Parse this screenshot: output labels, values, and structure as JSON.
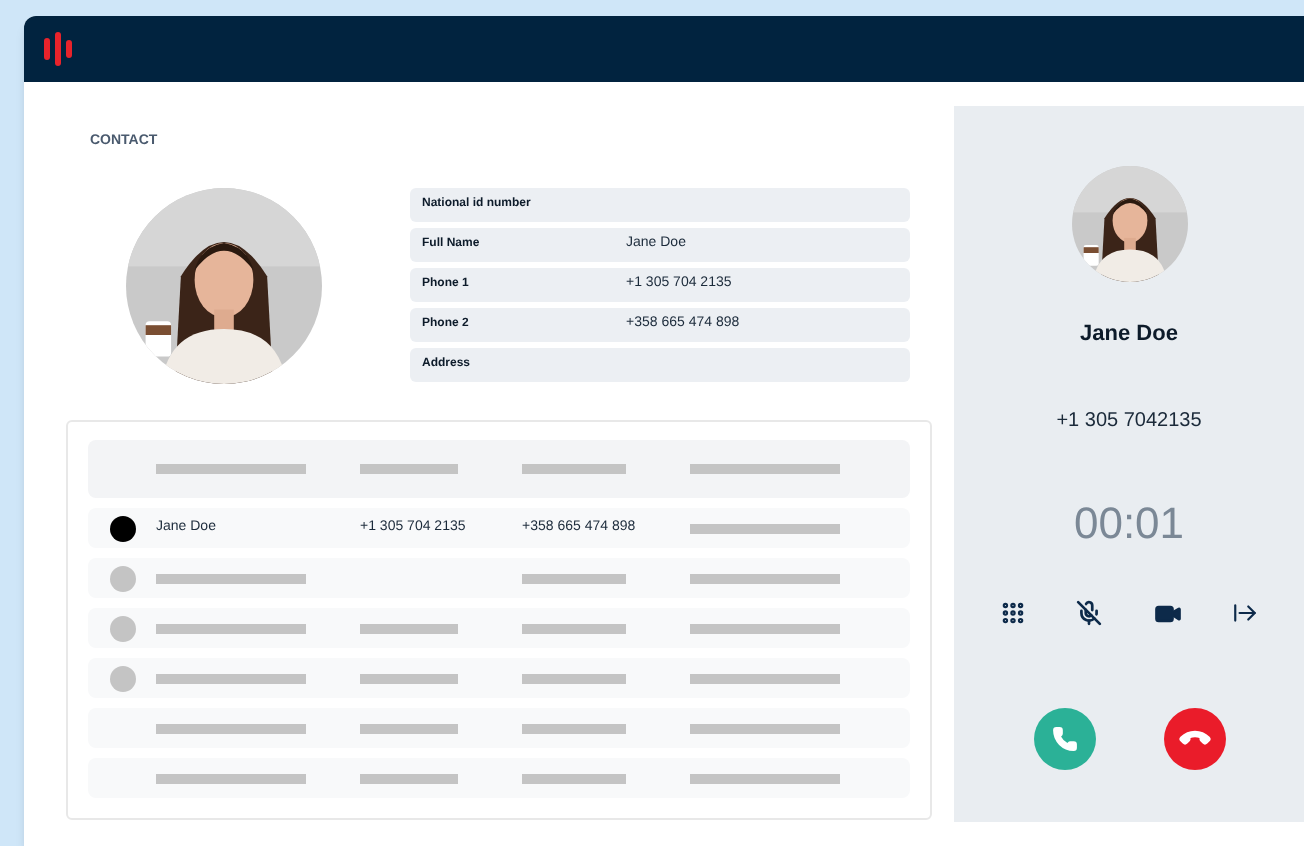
{
  "contact": {
    "section_title": "CONTACT"
  },
  "contact_fields": [
    {
      "label": "National id number"
    },
    {
      "label": "Full Name",
      "value": "Jane Doe"
    },
    {
      "label": "Phone 1",
      "value": "+1 305 704 2135"
    },
    {
      "label": "Phone 2",
      "value": "+358 665 474 898"
    },
    {
      "label": "Address"
    }
  ],
  "table": {
    "rows": [
      {
        "kind": "filled",
        "cells": [
          {
            "kind": "text",
            "text": "Jane Doe"
          },
          {
            "kind": "text",
            "text": "+1 305 704 2135"
          },
          {
            "kind": "text",
            "text": "+358 665 474 898"
          },
          {
            "kind": "placeholder"
          }
        ]
      },
      {
        "kind": "placeholder",
        "cells": [
          {
            "kind": "placeholder"
          },
          {
            "kind": "blank"
          },
          {
            "kind": "placeholder"
          },
          {
            "kind": "placeholder"
          }
        ]
      },
      {
        "kind": "placeholder",
        "cells": [
          {
            "kind": "placeholder"
          },
          {
            "kind": "placeholder"
          },
          {
            "kind": "placeholder"
          },
          {
            "kind": "placeholder"
          }
        ]
      },
      {
        "kind": "placeholder",
        "cells": [
          {
            "kind": "placeholder"
          },
          {
            "kind": "placeholder"
          },
          {
            "kind": "placeholder"
          },
          {
            "kind": "placeholder"
          }
        ]
      },
      {
        "kind": "plain",
        "cells": [
          {
            "kind": "placeholder"
          },
          {
            "kind": "placeholder"
          },
          {
            "kind": "placeholder"
          },
          {
            "kind": "placeholder"
          }
        ]
      },
      {
        "kind": "plain",
        "cells": [
          {
            "kind": "placeholder"
          },
          {
            "kind": "placeholder"
          },
          {
            "kind": "placeholder"
          },
          {
            "kind": "placeholder"
          }
        ]
      }
    ]
  },
  "call_panel": {
    "name": "Jane Doe",
    "phone": "+1 305 7042135",
    "timer": "00:01"
  }
}
